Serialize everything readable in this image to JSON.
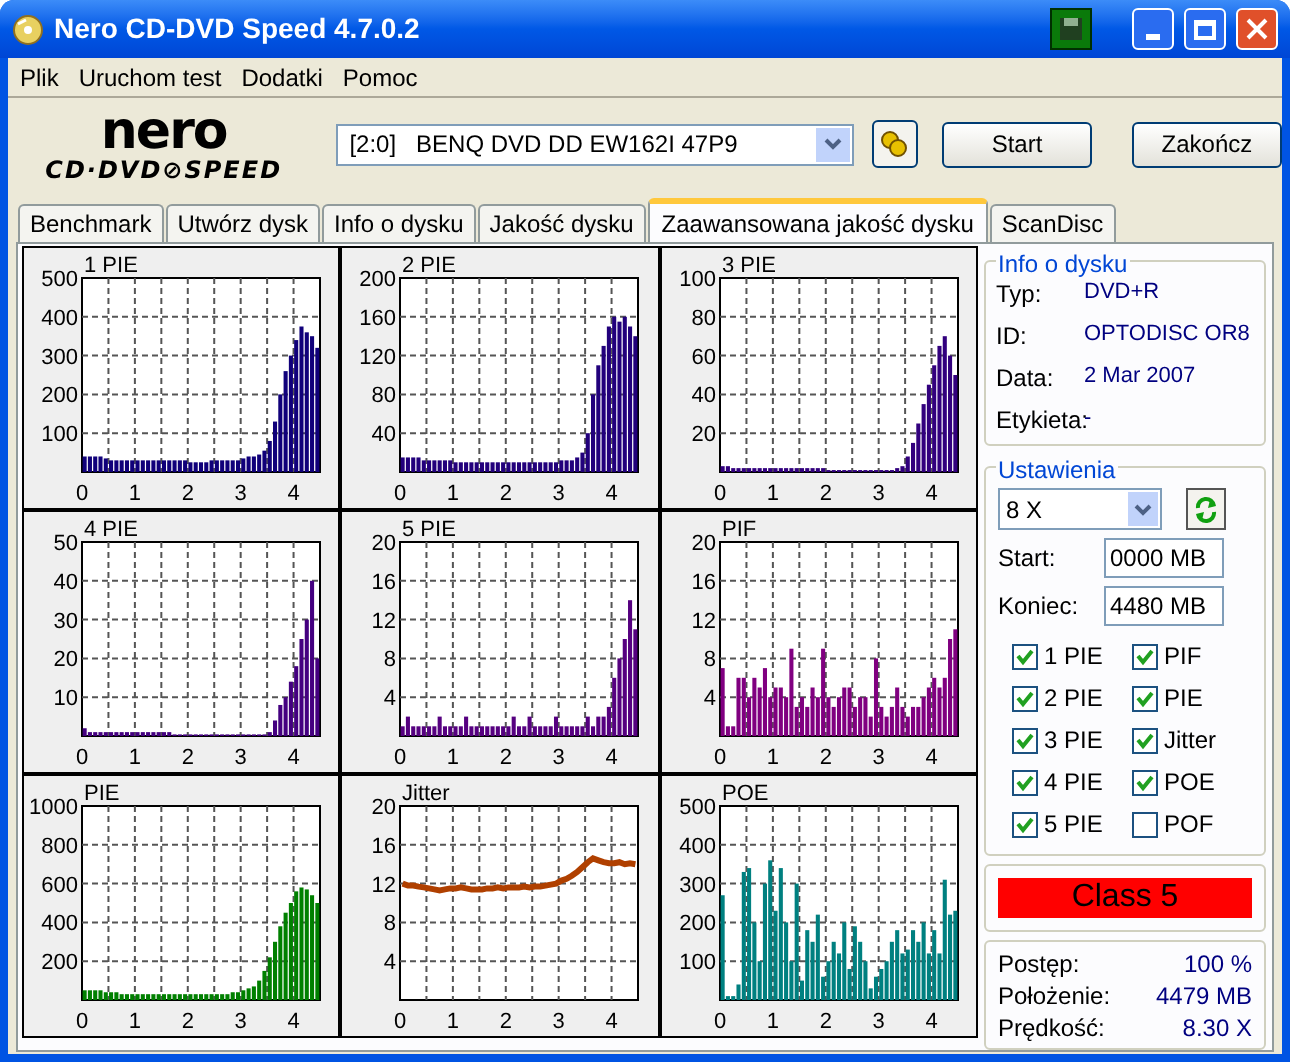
{
  "window": {
    "title": "Nero CD-DVD Speed 4.7.0.2"
  },
  "menu": [
    "Plik",
    "Uruchom test",
    "Dodatki",
    "Pomoc"
  ],
  "toolbar": {
    "logo_top": "nero",
    "logo_bottom": "CD·DVD⊘SPEED",
    "drive": "[2:0]   BENQ DVD DD EW162I 47P9",
    "buttons": [
      "Start",
      "Zakończ"
    ]
  },
  "tabs": [
    {
      "label": "Benchmark",
      "selected": false
    },
    {
      "label": "Utwórz dysk",
      "selected": false
    },
    {
      "label": "Info o dysku",
      "selected": false
    },
    {
      "label": "Jakość dysku",
      "selected": false
    },
    {
      "label": "Zaawansowana jakość dysku",
      "selected": true
    },
    {
      "label": "ScanDisc",
      "selected": false
    }
  ],
  "charts": [
    {
      "chart_data": {
        "type": "bar",
        "grid": true,
        "xlim": [
          0,
          4.5
        ],
        "ylim": [
          0,
          500
        ],
        "xticks": [
          0,
          1,
          2,
          3,
          4
        ],
        "yticks": [
          100,
          200,
          300,
          400,
          500
        ],
        "x": [
          0,
          0.1,
          0.2,
          0.3,
          0.4,
          0.5,
          0.6,
          0.7,
          0.8,
          0.9,
          1,
          1.1,
          1.2,
          1.3,
          1.4,
          1.5,
          1.6,
          1.7,
          1.8,
          1.9,
          2,
          2.1,
          2.2,
          2.3,
          2.4,
          2.5,
          2.6,
          2.7,
          2.8,
          2.9,
          3,
          3.1,
          3.2,
          3.3,
          3.4,
          3.5,
          3.6,
          3.7,
          3.8,
          3.9,
          4,
          4.1,
          4.2,
          4.3,
          4.4
        ],
        "series": [
          {
            "name": "1 PIE",
            "color": "#10007a",
            "values": [
              40,
              40,
              40,
              40,
              35,
              30,
              30,
              30,
              30,
              30,
              30,
              30,
              30,
              30,
              30,
              30,
              30,
              30,
              30,
              30,
              25,
              25,
              25,
              25,
              30,
              30,
              30,
              30,
              30,
              30,
              35,
              40,
              40,
              45,
              55,
              80,
              130,
              200,
              260,
              300,
              340,
              375,
              360,
              350,
              320
            ]
          }
        ]
      }
    },
    {
      "chart_data": {
        "type": "bar",
        "grid": true,
        "xlim": [
          0,
          4.5
        ],
        "ylim": [
          0,
          200
        ],
        "xticks": [
          0,
          1,
          2,
          3,
          4
        ],
        "yticks": [
          40,
          80,
          120,
          160,
          200
        ],
        "x": [
          0,
          0.1,
          0.2,
          0.3,
          0.4,
          0.5,
          0.6,
          0.7,
          0.8,
          0.9,
          1,
          1.1,
          1.2,
          1.3,
          1.4,
          1.5,
          1.6,
          1.7,
          1.8,
          1.9,
          2,
          2.1,
          2.2,
          2.3,
          2.4,
          2.5,
          2.6,
          2.7,
          2.8,
          2.9,
          3,
          3.1,
          3.2,
          3.3,
          3.4,
          3.5,
          3.6,
          3.7,
          3.8,
          3.9,
          4,
          4.1,
          4.2,
          4.3,
          4.4
        ],
        "series": [
          {
            "name": "2 PIE",
            "color": "#22007c",
            "values": [
              15,
              15,
              15,
              15,
              12,
              12,
              12,
              12,
              12,
              12,
              10,
              10,
              10,
              10,
              10,
              10,
              10,
              10,
              10,
              10,
              10,
              10,
              10,
              10,
              10,
              10,
              10,
              10,
              10,
              10,
              12,
              12,
              12,
              15,
              20,
              40,
              80,
              110,
              130,
              150,
              160,
              155,
              160,
              150,
              140
            ]
          }
        ]
      }
    },
    {
      "chart_data": {
        "type": "bar",
        "grid": true,
        "xlim": [
          0,
          4.5
        ],
        "ylim": [
          0,
          100
        ],
        "xticks": [
          0,
          1,
          2,
          3,
          4
        ],
        "yticks": [
          20,
          40,
          60,
          80,
          100
        ],
        "x": [
          0,
          0.1,
          0.2,
          0.3,
          0.4,
          0.5,
          0.6,
          0.7,
          0.8,
          0.9,
          1,
          1.1,
          1.2,
          1.3,
          1.4,
          1.5,
          1.6,
          1.7,
          1.8,
          1.9,
          2,
          2.1,
          2.2,
          2.3,
          2.4,
          2.5,
          2.6,
          2.7,
          2.8,
          2.9,
          3,
          3.1,
          3.2,
          3.3,
          3.4,
          3.5,
          3.6,
          3.7,
          3.8,
          3.9,
          4,
          4.1,
          4.2,
          4.3,
          4.4
        ],
        "series": [
          {
            "name": "3 PIE",
            "color": "#32007e",
            "values": [
              3,
              3,
              2,
              2,
              2,
              2,
              2,
              2,
              2,
              2,
              2,
              2,
              2,
              2,
              2,
              2,
              2,
              2,
              2,
              2,
              1,
              1,
              1,
              1,
              1,
              1,
              1,
              1,
              1,
              1,
              1,
              1,
              1,
              2,
              3,
              8,
              15,
              25,
              35,
              45,
              55,
              65,
              70,
              60,
              50
            ]
          }
        ]
      }
    },
    {
      "chart_data": {
        "type": "bar",
        "grid": true,
        "xlim": [
          0,
          4.5
        ],
        "ylim": [
          0,
          50
        ],
        "xticks": [
          0,
          1,
          2,
          3,
          4
        ],
        "yticks": [
          10,
          20,
          30,
          40,
          50
        ],
        "x": [
          0,
          0.1,
          0.2,
          0.3,
          0.4,
          0.5,
          0.6,
          0.7,
          0.8,
          0.9,
          1,
          1.1,
          1.2,
          1.3,
          1.4,
          1.5,
          1.6,
          1.7,
          1.8,
          1.9,
          2,
          2.1,
          2.2,
          2.3,
          2.4,
          2.5,
          2.6,
          2.7,
          2.8,
          2.9,
          3,
          3.1,
          3.2,
          3.3,
          3.4,
          3.5,
          3.6,
          3.7,
          3.8,
          3.9,
          4,
          4.1,
          4.2,
          4.3,
          4.4
        ],
        "series": [
          {
            "name": "4 PIE",
            "color": "#440080",
            "values": [
              2,
              1,
              1,
              1,
              1,
              1,
              1,
              1,
              1,
              1,
              1,
              1,
              1,
              1,
              1,
              1,
              1,
              0,
              0,
              0,
              0,
              0,
              0,
              0,
              0,
              0,
              0,
              0,
              0,
              0,
              0,
              0,
              0,
              0,
              0,
              1,
              4,
              8,
              10,
              14,
              18,
              25,
              30,
              40,
              20
            ]
          }
        ]
      }
    },
    {
      "chart_data": {
        "type": "bar",
        "grid": true,
        "xlim": [
          0,
          4.5
        ],
        "ylim": [
          0,
          20
        ],
        "xticks": [
          0,
          1,
          2,
          3,
          4
        ],
        "yticks": [
          4,
          8,
          12,
          16,
          20
        ],
        "x": [
          0,
          0.1,
          0.2,
          0.3,
          0.4,
          0.5,
          0.6,
          0.7,
          0.8,
          0.9,
          1,
          1.1,
          1.2,
          1.3,
          1.4,
          1.5,
          1.6,
          1.7,
          1.8,
          1.9,
          2,
          2.1,
          2.2,
          2.3,
          2.4,
          2.5,
          2.6,
          2.7,
          2.8,
          2.9,
          3,
          3.1,
          3.2,
          3.3,
          3.4,
          3.5,
          3.6,
          3.7,
          3.8,
          3.9,
          4,
          4.1,
          4.2,
          4.3,
          4.4
        ],
        "series": [
          {
            "name": "5 PIE",
            "color": "#560080",
            "values": [
              1,
              2,
              1,
              1,
              1,
              1,
              1,
              2,
              1,
              1,
              1,
              1,
              2,
              1,
              1,
              1,
              1,
              1,
              1,
              1,
              1,
              2,
              1,
              1,
              2,
              1,
              1,
              1,
              1,
              2,
              1,
              1,
              1,
              1,
              1,
              2,
              1,
              2,
              2,
              3,
              6,
              8,
              10,
              14,
              11
            ]
          }
        ]
      }
    },
    {
      "chart_data": {
        "type": "bar",
        "grid": true,
        "xlim": [
          0,
          4.5
        ],
        "ylim": [
          0,
          20
        ],
        "xticks": [
          0,
          1,
          2,
          3,
          4
        ],
        "yticks": [
          4,
          8,
          12,
          16,
          20
        ],
        "x": [
          0,
          0.1,
          0.2,
          0.3,
          0.4,
          0.5,
          0.6,
          0.7,
          0.8,
          0.9,
          1,
          1.1,
          1.2,
          1.3,
          1.4,
          1.5,
          1.6,
          1.7,
          1.8,
          1.9,
          2,
          2.1,
          2.2,
          2.3,
          2.4,
          2.5,
          2.6,
          2.7,
          2.8,
          2.9,
          3,
          3.1,
          3.2,
          3.3,
          3.4,
          3.5,
          3.6,
          3.7,
          3.8,
          3.9,
          4,
          4.1,
          4.2,
          4.3,
          4.4
        ],
        "series": [
          {
            "name": "PIF",
            "color": "#800080",
            "values": [
              7,
              1,
              1,
              6,
              6,
              4,
              6,
              5,
              7,
              4,
              5,
              5,
              4,
              9,
              3,
              4,
              3,
              5,
              4,
              9,
              4,
              3,
              4,
              5,
              5,
              3,
              4,
              4,
              2,
              8,
              3,
              2,
              3,
              5,
              3,
              2,
              3,
              3,
              4,
              5,
              6,
              5,
              6,
              10,
              11
            ]
          }
        ]
      }
    },
    {
      "chart_data": {
        "type": "bar",
        "grid": true,
        "xlim": [
          0,
          4.5
        ],
        "ylim": [
          0,
          1000
        ],
        "xticks": [
          0,
          1,
          2,
          3,
          4
        ],
        "yticks": [
          200,
          400,
          600,
          800,
          1000
        ],
        "x": [
          0,
          0.1,
          0.2,
          0.3,
          0.4,
          0.5,
          0.6,
          0.7,
          0.8,
          0.9,
          1,
          1.1,
          1.2,
          1.3,
          1.4,
          1.5,
          1.6,
          1.7,
          1.8,
          1.9,
          2,
          2.1,
          2.2,
          2.3,
          2.4,
          2.5,
          2.6,
          2.7,
          2.8,
          2.9,
          3,
          3.1,
          3.2,
          3.3,
          3.4,
          3.5,
          3.6,
          3.7,
          3.8,
          3.9,
          4,
          4.1,
          4.2,
          4.3,
          4.4
        ],
        "series": [
          {
            "name": "PIE",
            "color": "#008000",
            "values": [
              50,
              50,
              50,
              50,
              40,
              40,
              40,
              30,
              30,
              30,
              30,
              30,
              30,
              30,
              30,
              30,
              30,
              30,
              30,
              30,
              30,
              30,
              30,
              30,
              30,
              30,
              30,
              30,
              40,
              40,
              50,
              60,
              70,
              100,
              150,
              220,
              300,
              380,
              450,
              500,
              560,
              580,
              570,
              540,
              500
            ]
          }
        ]
      }
    },
    {
      "chart_data": {
        "type": "line",
        "grid": true,
        "xlim": [
          0,
          4.5
        ],
        "ylim": [
          0,
          20
        ],
        "xticks": [
          0,
          1,
          2,
          3,
          4
        ],
        "yticks": [
          4,
          8,
          12,
          16,
          20
        ],
        "x": [
          0,
          0.1,
          0.2,
          0.3,
          0.4,
          0.5,
          0.6,
          0.7,
          0.8,
          0.9,
          1,
          1.1,
          1.2,
          1.3,
          1.4,
          1.5,
          1.6,
          1.7,
          1.8,
          1.9,
          2,
          2.1,
          2.2,
          2.3,
          2.4,
          2.5,
          2.6,
          2.7,
          2.8,
          2.9,
          3,
          3.1,
          3.2,
          3.3,
          3.4,
          3.5,
          3.6,
          3.7,
          3.8,
          3.9,
          4,
          4.1,
          4.2,
          4.3,
          4.4
        ],
        "series": [
          {
            "name": "Jitter",
            "color": "#b04000",
            "values": [
              12,
              11.8,
              11.8,
              11.7,
              11.6,
              11.5,
              11.4,
              11.3,
              11.4,
              11.5,
              11.5,
              11.6,
              11.5,
              11.4,
              11.4,
              11.4,
              11.5,
              11.5,
              11.6,
              11.5,
              11.6,
              11.6,
              11.6,
              11.7,
              11.6,
              11.7,
              11.7,
              11.8,
              11.9,
              12,
              12.3,
              12.5,
              12.8,
              13.2,
              13.7,
              14.2,
              14.6,
              14.4,
              14.2,
              14.1,
              14.1,
              14.2,
              14,
              14.1,
              14
            ]
          }
        ]
      }
    },
    {
      "chart_data": {
        "type": "bar",
        "grid": true,
        "xlim": [
          0,
          4.5
        ],
        "ylim": [
          0,
          500
        ],
        "xticks": [
          0,
          1,
          2,
          3,
          4
        ],
        "yticks": [
          100,
          200,
          300,
          400,
          500
        ],
        "x": [
          0,
          0.1,
          0.2,
          0.3,
          0.4,
          0.5,
          0.6,
          0.7,
          0.8,
          0.9,
          1,
          1.1,
          1.2,
          1.3,
          1.4,
          1.5,
          1.6,
          1.7,
          1.8,
          1.9,
          2,
          2.1,
          2.2,
          2.3,
          2.4,
          2.5,
          2.6,
          2.7,
          2.8,
          2.9,
          3,
          3.1,
          3.2,
          3.3,
          3.4,
          3.5,
          3.6,
          3.7,
          3.8,
          3.9,
          4,
          4.1,
          4.2,
          4.3,
          4.4
        ],
        "series": [
          {
            "name": "POE",
            "color": "#008080",
            "values": [
              270,
              10,
              10,
              40,
              330,
              340,
              200,
              100,
              300,
              360,
              230,
              340,
              200,
              100,
              300,
              50,
              180,
              150,
              220,
              60,
              100,
              150,
              120,
              200,
              80,
              190,
              150,
              100,
              30,
              60,
              80,
              100,
              150,
              180,
              120,
              130,
              180,
              150,
              200,
              120,
              180,
              120,
              310,
              220,
              230
            ]
          }
        ]
      }
    }
  ],
  "disc_info": {
    "title": "Info o dysku",
    "rows": [
      {
        "label": "Typ:",
        "value": "DVD+R"
      },
      {
        "label": "ID:",
        "value": "OPTODISC OR8"
      },
      {
        "label": "Data:",
        "value": "2 Mar 2007"
      },
      {
        "label": "Etykieta:",
        "value": "-"
      }
    ]
  },
  "settings": {
    "title": "Ustawienia",
    "speed": "8 X",
    "start_label": "Start:",
    "start": "0000 MB",
    "end_label": "Koniec:",
    "end": "4480 MB",
    "checkboxes": [
      {
        "label": "1 PIE",
        "checked": true
      },
      {
        "label": "PIF",
        "checked": true
      },
      {
        "label": "2 PIE",
        "checked": true
      },
      {
        "label": "PIE",
        "checked": true
      },
      {
        "label": "3 PIE",
        "checked": true
      },
      {
        "label": "Jitter",
        "checked": true
      },
      {
        "label": "4 PIE",
        "checked": true
      },
      {
        "label": "POE",
        "checked": true
      },
      {
        "label": "5 PIE",
        "checked": true
      },
      {
        "label": "POF",
        "checked": false
      }
    ]
  },
  "result": "Class 5",
  "progress": [
    {
      "label": "Postęp:",
      "value": "100 %"
    },
    {
      "label": "Położenie:",
      "value": "4479 MB"
    },
    {
      "label": "Prędkość:",
      "value": "8.30 X"
    }
  ]
}
